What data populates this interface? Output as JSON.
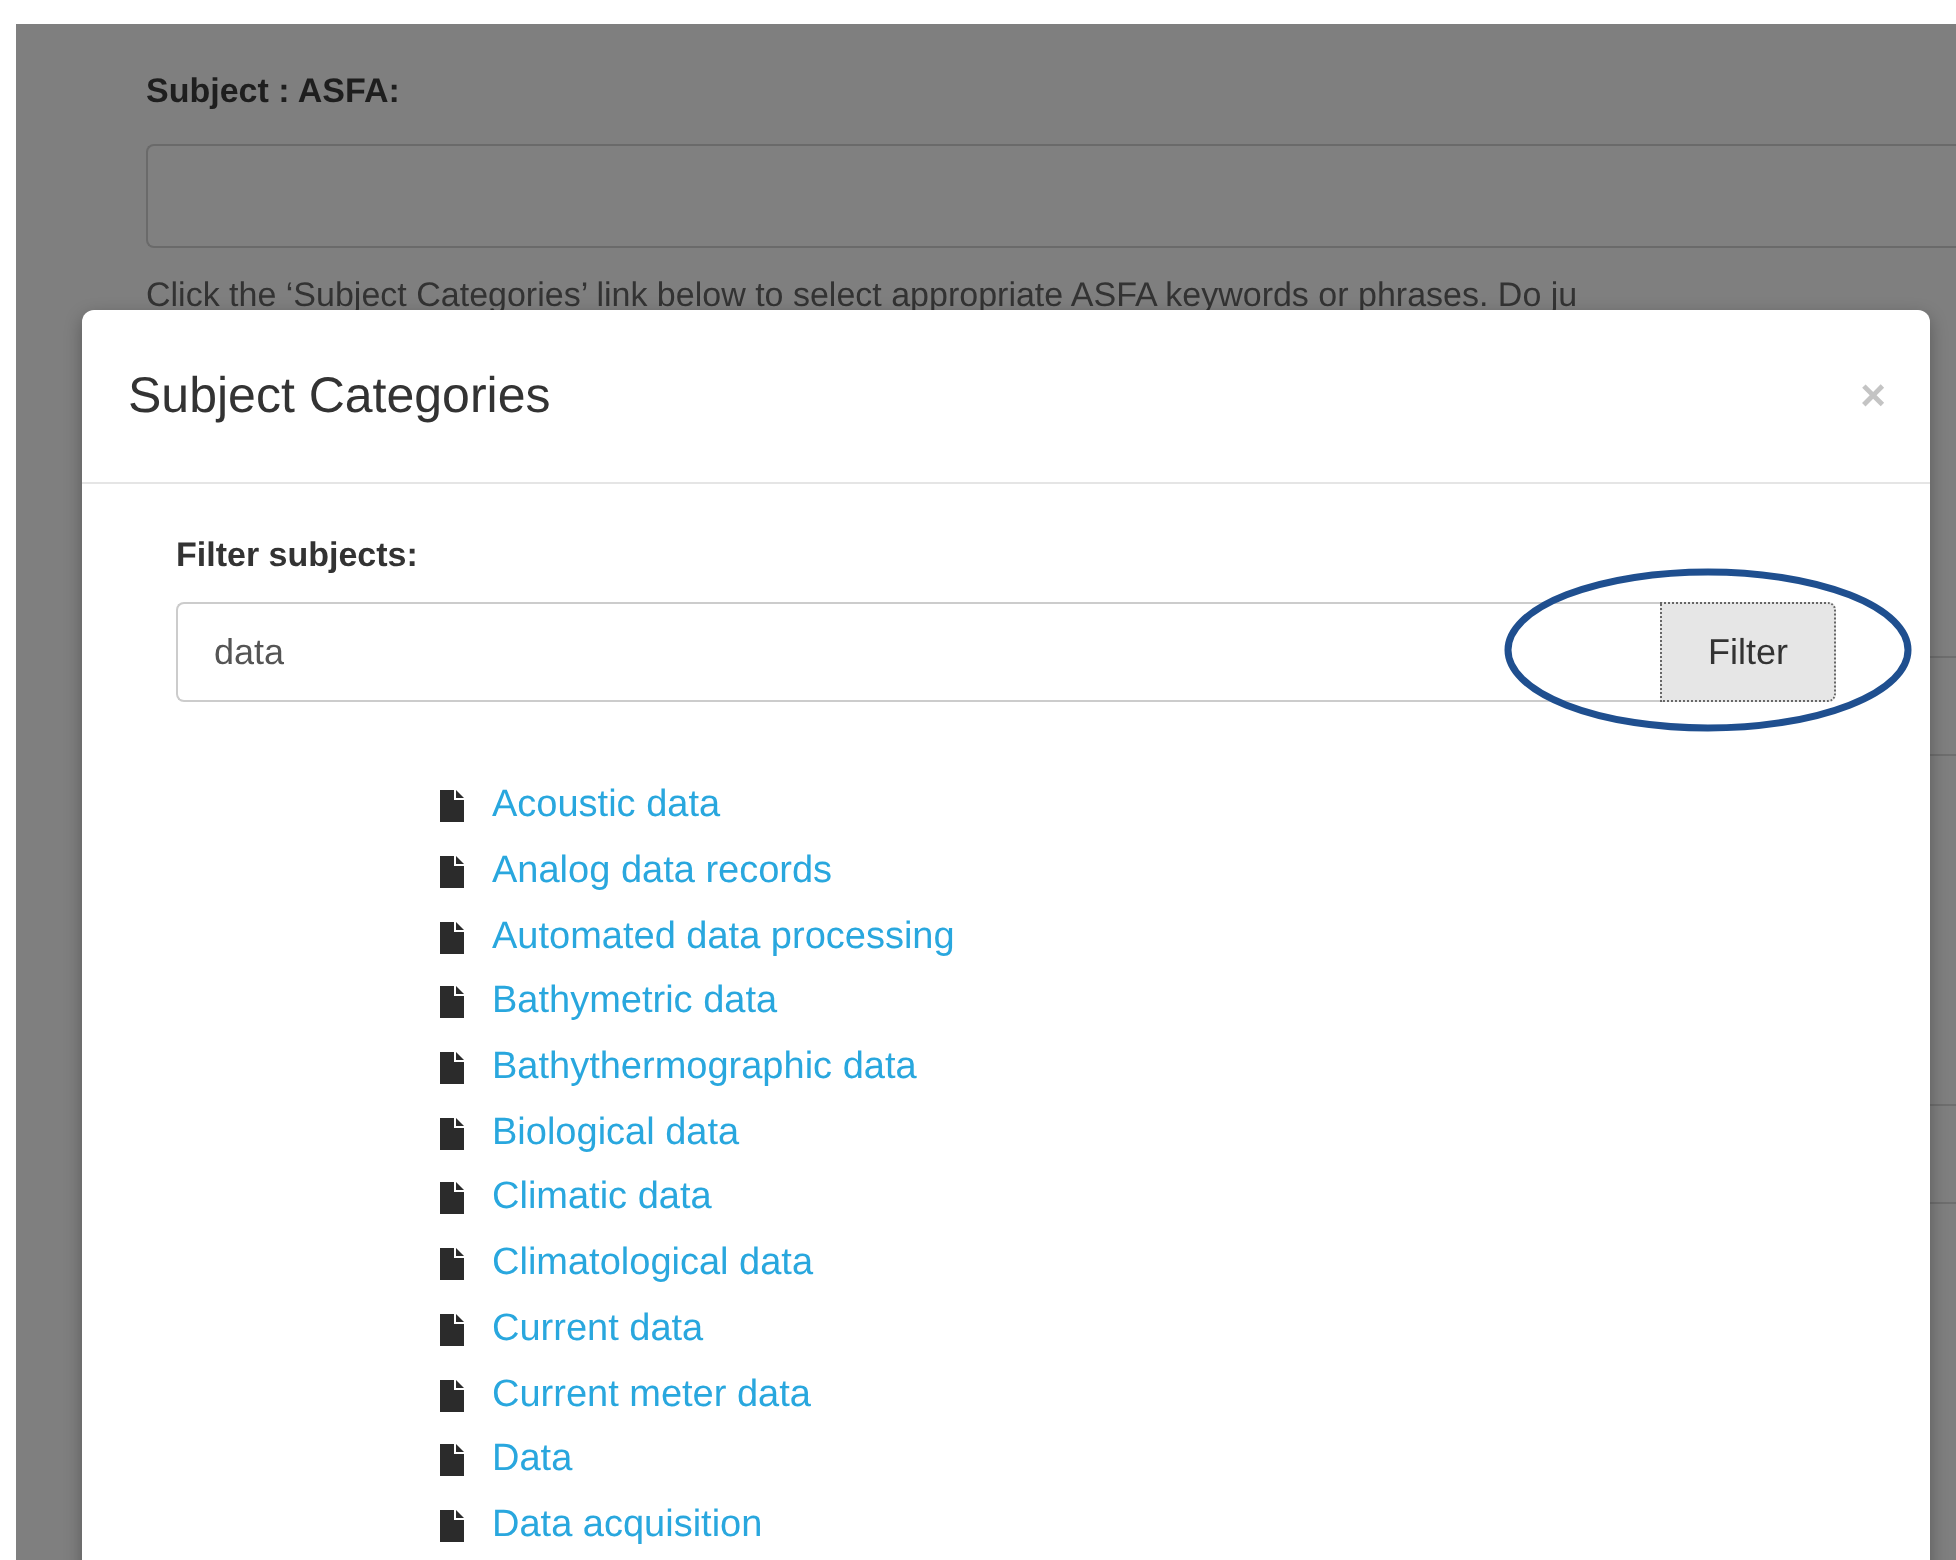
{
  "page": {
    "subject_label": "Subject : ASFA:",
    "help_text": "Click the ‘Subject Categories’ link below to select appropriate ASFA keywords or phrases. Do ju"
  },
  "modal": {
    "title": "Subject Categories",
    "close": "×",
    "filter": {
      "label": "Filter subjects:",
      "value": "data",
      "button": "Filter",
      "highlighted": true
    },
    "subjects": [
      {
        "label": "Acoustic data"
      },
      {
        "label": "Analog data records"
      },
      {
        "label": "Automated data processing"
      },
      {
        "label": "Bathymetric data"
      },
      {
        "label": "Bathythermographic data"
      },
      {
        "label": "Biological data"
      },
      {
        "label": "Climatic data"
      },
      {
        "label": "Climatological data"
      },
      {
        "label": "Current data"
      },
      {
        "label": "Current meter data"
      },
      {
        "label": "Data"
      },
      {
        "label": "Data acquisition"
      }
    ]
  }
}
